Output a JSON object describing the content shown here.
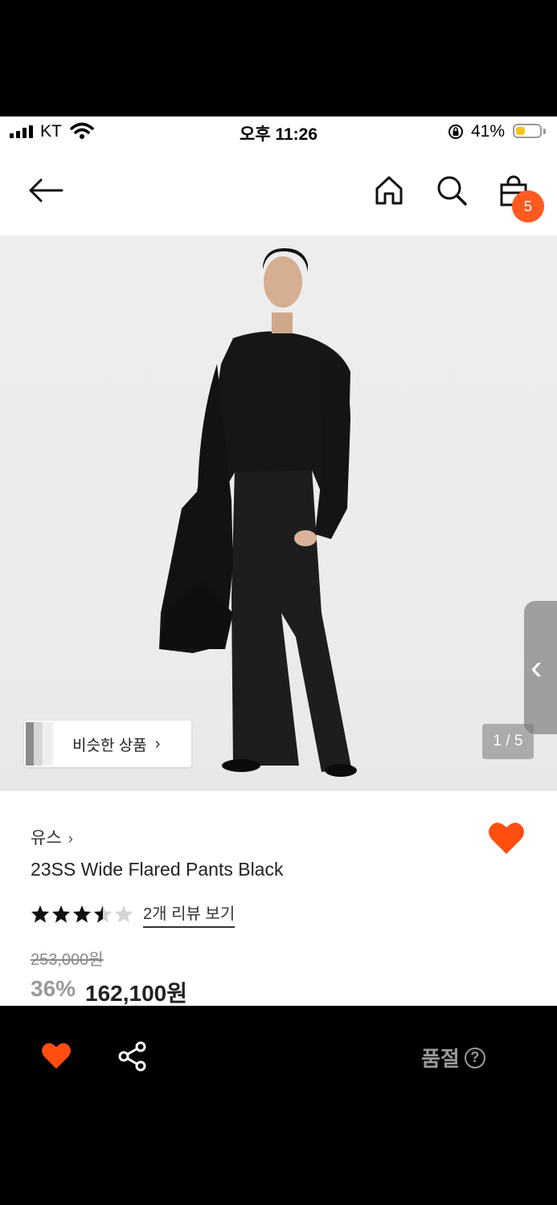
{
  "status_bar": {
    "carrier": "KT",
    "time": "오후 11:26",
    "battery_percent": "41%",
    "battery_level": 0.41,
    "battery_color": "#f5c518"
  },
  "nav": {
    "back_icon": "arrow-left-icon",
    "home_icon": "home-icon",
    "search_icon": "search-icon",
    "cart_icon": "shopping-bag-icon",
    "cart_count": "5",
    "badge_color": "#ff5a1f"
  },
  "gallery": {
    "similar_products_label": "비슷한 상품",
    "similar_chevron": "›",
    "pager": "1 / 5",
    "side_tab_chevron": "‹"
  },
  "product": {
    "brand": "유스",
    "brand_chevron": "›",
    "title": "23SS Wide Flared Pants Black",
    "rating": 3.5,
    "rating_max": 5,
    "reviews_link": "2개 리뷰 보기",
    "original_price": "253,000원",
    "discount": "36%",
    "price": "162,100원",
    "wishlisted": true,
    "accent_color": "#ff4e0f"
  },
  "bottom_bar": {
    "wish_icon": "heart-icon",
    "share_icon": "share-icon",
    "status_label": "품절",
    "help_icon_glyph": "?"
  }
}
